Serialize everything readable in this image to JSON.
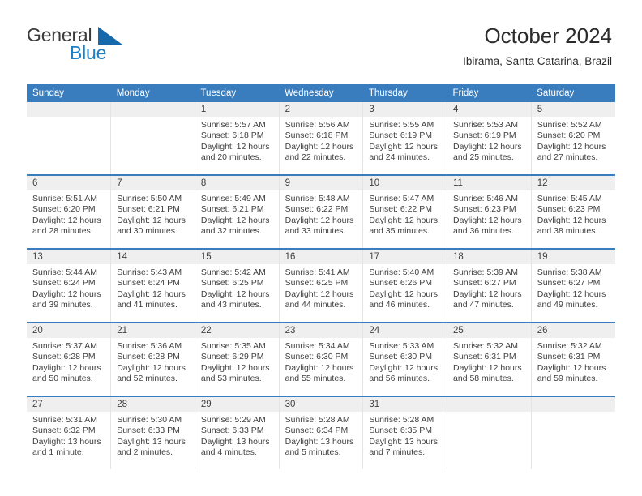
{
  "brand": {
    "name_part1": "General",
    "name_part2": "Blue",
    "triangle_icon": "triangle-icon",
    "color_dark": "#3a3a3a",
    "color_blue": "#1f7fc4"
  },
  "header": {
    "title": "October 2024",
    "subtitle": "Ibirama, Santa Catarina, Brazil"
  },
  "theme": {
    "header_blue": "#3a7dbf",
    "daynum_band": "#efefef",
    "text": "#404040"
  },
  "weekdays": [
    "Sunday",
    "Monday",
    "Tuesday",
    "Wednesday",
    "Thursday",
    "Friday",
    "Saturday"
  ],
  "weeks": [
    [
      {
        "day": "",
        "sunrise": "",
        "sunset": "",
        "daylight1": "",
        "daylight2": ""
      },
      {
        "day": "",
        "sunrise": "",
        "sunset": "",
        "daylight1": "",
        "daylight2": ""
      },
      {
        "day": "1",
        "sunrise": "Sunrise: 5:57 AM",
        "sunset": "Sunset: 6:18 PM",
        "daylight1": "Daylight: 12 hours",
        "daylight2": "and 20 minutes."
      },
      {
        "day": "2",
        "sunrise": "Sunrise: 5:56 AM",
        "sunset": "Sunset: 6:18 PM",
        "daylight1": "Daylight: 12 hours",
        "daylight2": "and 22 minutes."
      },
      {
        "day": "3",
        "sunrise": "Sunrise: 5:55 AM",
        "sunset": "Sunset: 6:19 PM",
        "daylight1": "Daylight: 12 hours",
        "daylight2": "and 24 minutes."
      },
      {
        "day": "4",
        "sunrise": "Sunrise: 5:53 AM",
        "sunset": "Sunset: 6:19 PM",
        "daylight1": "Daylight: 12 hours",
        "daylight2": "and 25 minutes."
      },
      {
        "day": "5",
        "sunrise": "Sunrise: 5:52 AM",
        "sunset": "Sunset: 6:20 PM",
        "daylight1": "Daylight: 12 hours",
        "daylight2": "and 27 minutes."
      }
    ],
    [
      {
        "day": "6",
        "sunrise": "Sunrise: 5:51 AM",
        "sunset": "Sunset: 6:20 PM",
        "daylight1": "Daylight: 12 hours",
        "daylight2": "and 28 minutes."
      },
      {
        "day": "7",
        "sunrise": "Sunrise: 5:50 AM",
        "sunset": "Sunset: 6:21 PM",
        "daylight1": "Daylight: 12 hours",
        "daylight2": "and 30 minutes."
      },
      {
        "day": "8",
        "sunrise": "Sunrise: 5:49 AM",
        "sunset": "Sunset: 6:21 PM",
        "daylight1": "Daylight: 12 hours",
        "daylight2": "and 32 minutes."
      },
      {
        "day": "9",
        "sunrise": "Sunrise: 5:48 AM",
        "sunset": "Sunset: 6:22 PM",
        "daylight1": "Daylight: 12 hours",
        "daylight2": "and 33 minutes."
      },
      {
        "day": "10",
        "sunrise": "Sunrise: 5:47 AM",
        "sunset": "Sunset: 6:22 PM",
        "daylight1": "Daylight: 12 hours",
        "daylight2": "and 35 minutes."
      },
      {
        "day": "11",
        "sunrise": "Sunrise: 5:46 AM",
        "sunset": "Sunset: 6:23 PM",
        "daylight1": "Daylight: 12 hours",
        "daylight2": "and 36 minutes."
      },
      {
        "day": "12",
        "sunrise": "Sunrise: 5:45 AM",
        "sunset": "Sunset: 6:23 PM",
        "daylight1": "Daylight: 12 hours",
        "daylight2": "and 38 minutes."
      }
    ],
    [
      {
        "day": "13",
        "sunrise": "Sunrise: 5:44 AM",
        "sunset": "Sunset: 6:24 PM",
        "daylight1": "Daylight: 12 hours",
        "daylight2": "and 39 minutes."
      },
      {
        "day": "14",
        "sunrise": "Sunrise: 5:43 AM",
        "sunset": "Sunset: 6:24 PM",
        "daylight1": "Daylight: 12 hours",
        "daylight2": "and 41 minutes."
      },
      {
        "day": "15",
        "sunrise": "Sunrise: 5:42 AM",
        "sunset": "Sunset: 6:25 PM",
        "daylight1": "Daylight: 12 hours",
        "daylight2": "and 43 minutes."
      },
      {
        "day": "16",
        "sunrise": "Sunrise: 5:41 AM",
        "sunset": "Sunset: 6:25 PM",
        "daylight1": "Daylight: 12 hours",
        "daylight2": "and 44 minutes."
      },
      {
        "day": "17",
        "sunrise": "Sunrise: 5:40 AM",
        "sunset": "Sunset: 6:26 PM",
        "daylight1": "Daylight: 12 hours",
        "daylight2": "and 46 minutes."
      },
      {
        "day": "18",
        "sunrise": "Sunrise: 5:39 AM",
        "sunset": "Sunset: 6:27 PM",
        "daylight1": "Daylight: 12 hours",
        "daylight2": "and 47 minutes."
      },
      {
        "day": "19",
        "sunrise": "Sunrise: 5:38 AM",
        "sunset": "Sunset: 6:27 PM",
        "daylight1": "Daylight: 12 hours",
        "daylight2": "and 49 minutes."
      }
    ],
    [
      {
        "day": "20",
        "sunrise": "Sunrise: 5:37 AM",
        "sunset": "Sunset: 6:28 PM",
        "daylight1": "Daylight: 12 hours",
        "daylight2": "and 50 minutes."
      },
      {
        "day": "21",
        "sunrise": "Sunrise: 5:36 AM",
        "sunset": "Sunset: 6:28 PM",
        "daylight1": "Daylight: 12 hours",
        "daylight2": "and 52 minutes."
      },
      {
        "day": "22",
        "sunrise": "Sunrise: 5:35 AM",
        "sunset": "Sunset: 6:29 PM",
        "daylight1": "Daylight: 12 hours",
        "daylight2": "and 53 minutes."
      },
      {
        "day": "23",
        "sunrise": "Sunrise: 5:34 AM",
        "sunset": "Sunset: 6:30 PM",
        "daylight1": "Daylight: 12 hours",
        "daylight2": "and 55 minutes."
      },
      {
        "day": "24",
        "sunrise": "Sunrise: 5:33 AM",
        "sunset": "Sunset: 6:30 PM",
        "daylight1": "Daylight: 12 hours",
        "daylight2": "and 56 minutes."
      },
      {
        "day": "25",
        "sunrise": "Sunrise: 5:32 AM",
        "sunset": "Sunset: 6:31 PM",
        "daylight1": "Daylight: 12 hours",
        "daylight2": "and 58 minutes."
      },
      {
        "day": "26",
        "sunrise": "Sunrise: 5:32 AM",
        "sunset": "Sunset: 6:31 PM",
        "daylight1": "Daylight: 12 hours",
        "daylight2": "and 59 minutes."
      }
    ],
    [
      {
        "day": "27",
        "sunrise": "Sunrise: 5:31 AM",
        "sunset": "Sunset: 6:32 PM",
        "daylight1": "Daylight: 13 hours",
        "daylight2": "and 1 minute."
      },
      {
        "day": "28",
        "sunrise": "Sunrise: 5:30 AM",
        "sunset": "Sunset: 6:33 PM",
        "daylight1": "Daylight: 13 hours",
        "daylight2": "and 2 minutes."
      },
      {
        "day": "29",
        "sunrise": "Sunrise: 5:29 AM",
        "sunset": "Sunset: 6:33 PM",
        "daylight1": "Daylight: 13 hours",
        "daylight2": "and 4 minutes."
      },
      {
        "day": "30",
        "sunrise": "Sunrise: 5:28 AM",
        "sunset": "Sunset: 6:34 PM",
        "daylight1": "Daylight: 13 hours",
        "daylight2": "and 5 minutes."
      },
      {
        "day": "31",
        "sunrise": "Sunrise: 5:28 AM",
        "sunset": "Sunset: 6:35 PM",
        "daylight1": "Daylight: 13 hours",
        "daylight2": "and 7 minutes."
      },
      {
        "day": "",
        "sunrise": "",
        "sunset": "",
        "daylight1": "",
        "daylight2": ""
      },
      {
        "day": "",
        "sunrise": "",
        "sunset": "",
        "daylight1": "",
        "daylight2": ""
      }
    ]
  ]
}
